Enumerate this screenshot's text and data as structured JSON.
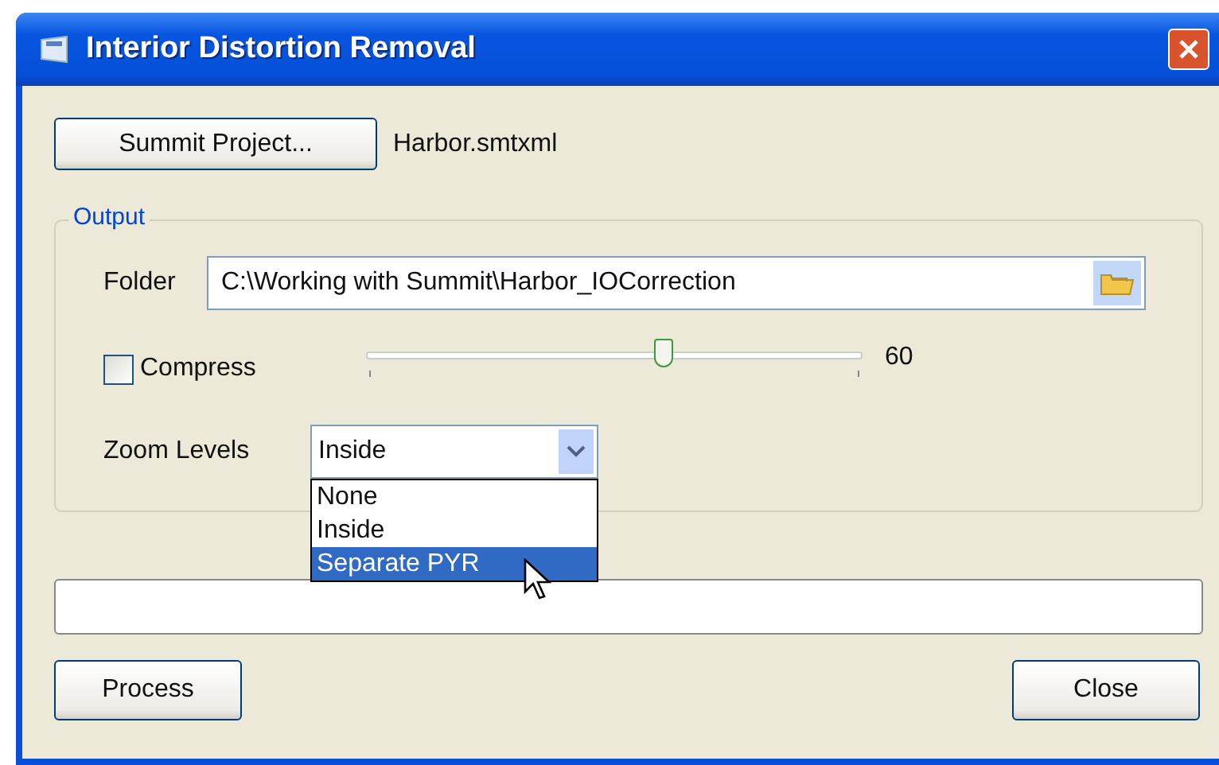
{
  "window": {
    "title": "Interior Distortion Removal"
  },
  "project": {
    "button": "Summit Project...",
    "file": "Harbor.smtxml"
  },
  "output": {
    "title": "Output",
    "folder_label": "Folder",
    "folder_value": "C:\\Working with Summit\\Harbor_IOCorrection",
    "compress": {
      "label": "Compress",
      "checked": false
    },
    "slider": {
      "level": 0.6,
      "reading": "60"
    },
    "zoom_label": "Zoom Levels",
    "zoom_value": "Inside",
    "zoom_options": [
      {
        "label": "None",
        "selected": false
      },
      {
        "label": "Inside",
        "selected": false
      },
      {
        "label": "Separate PYR",
        "selected": true
      }
    ]
  },
  "progress": {
    "level": 0
  },
  "buttons": {
    "process": "Process",
    "close": "Close"
  }
}
